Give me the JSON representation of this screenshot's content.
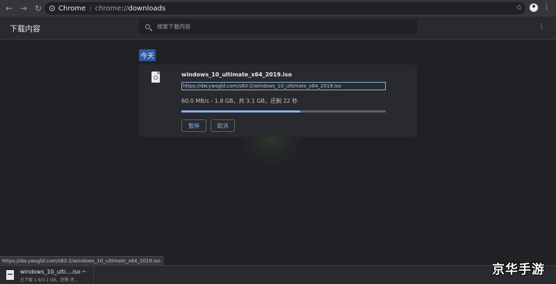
{
  "browser": {
    "site_name": "Chrome",
    "url_prefix": "chrome://",
    "url_path": "downloads",
    "back_icon": "←",
    "forward_icon": "→",
    "reload_icon": "↻",
    "star_icon": "☆",
    "menu_icon": "⋮"
  },
  "header": {
    "title": "下载内容",
    "search_placeholder": "搜索下载内容",
    "menu_icon": "⋮"
  },
  "date_label": "今天",
  "download": {
    "file_name": "windows_10_ultimate_x64_2019.iso",
    "url": "https://dw.ywsgld.com/s60-2/windows_10_ultimate_x64_2019.iso",
    "progress_text": "60.0 MB/s - 1.8 GB，共 3.1 GB，还剩 22 秒",
    "progress_fraction": 0.58,
    "pause_label": "暂停",
    "cancel_label": "取消"
  },
  "status_bar_url": "https://dw.ywsgld.com/s60-2/windows_10_ultimate_x64_2019.iso",
  "shelf": {
    "file_name": "windows_10_ulti....iso",
    "status": "已下载 1.9/3.1 GB，还需 还...",
    "chevron_icon": "^"
  },
  "brand_logo_text": "京华手游",
  "colors": {
    "accent": "#8ab4f8",
    "background": "#202124",
    "card": "#292a2d",
    "date_highlight": "#2d5aa0"
  }
}
